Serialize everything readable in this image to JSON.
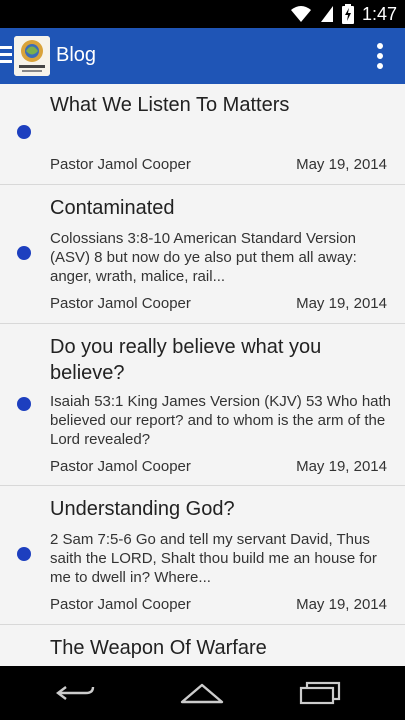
{
  "status_bar": {
    "time": "1:47",
    "icons": [
      "wifi-icon",
      "signal-icon",
      "battery-charging-icon"
    ]
  },
  "app_bar": {
    "title": "Blog",
    "logo_icon": "new-life-logo-icon",
    "menu_icon": "hamburger-icon",
    "overflow_icon": "overflow-menu-icon"
  },
  "colors": {
    "app_bar": "#1f55b6",
    "unread_dot": "#1d3fbf",
    "list_background": "#f4f4f4"
  },
  "posts": [
    {
      "title": "What We Listen To Matters",
      "excerpt": "",
      "author": "Pastor Jamol Cooper",
      "date": "May 19, 2014",
      "unread": true
    },
    {
      "title": "Contaminated",
      "excerpt": "Colossians 3:8-10 American Standard Version (ASV) 8 but now do ye also put them all away: anger, wrath, malice, rail...",
      "author": "Pastor Jamol Cooper",
      "date": "May 19, 2014",
      "unread": true
    },
    {
      "title": "Do you really believe what you believe?",
      "excerpt": "Isaiah 53:1 King James Version (KJV) 53 Who hath believed our report? and to whom is the arm of the Lord revealed?",
      "author": "Pastor Jamol Cooper",
      "date": "May 19, 2014",
      "unread": true
    },
    {
      "title": "Understanding God?",
      "excerpt": "2 Sam 7:5-6 Go and tell my servant David, Thus saith the LORD, Shalt thou build me an house for me to dwell in? Where...",
      "author": "Pastor Jamol Cooper",
      "date": "May 19, 2014",
      "unread": true
    },
    {
      "title": "The Weapon Of Warfare",
      "excerpt": "",
      "author": "",
      "date": "",
      "unread": false
    }
  ],
  "nav_bar": {
    "icons": [
      "back-icon",
      "home-icon",
      "recent-apps-icon"
    ]
  }
}
